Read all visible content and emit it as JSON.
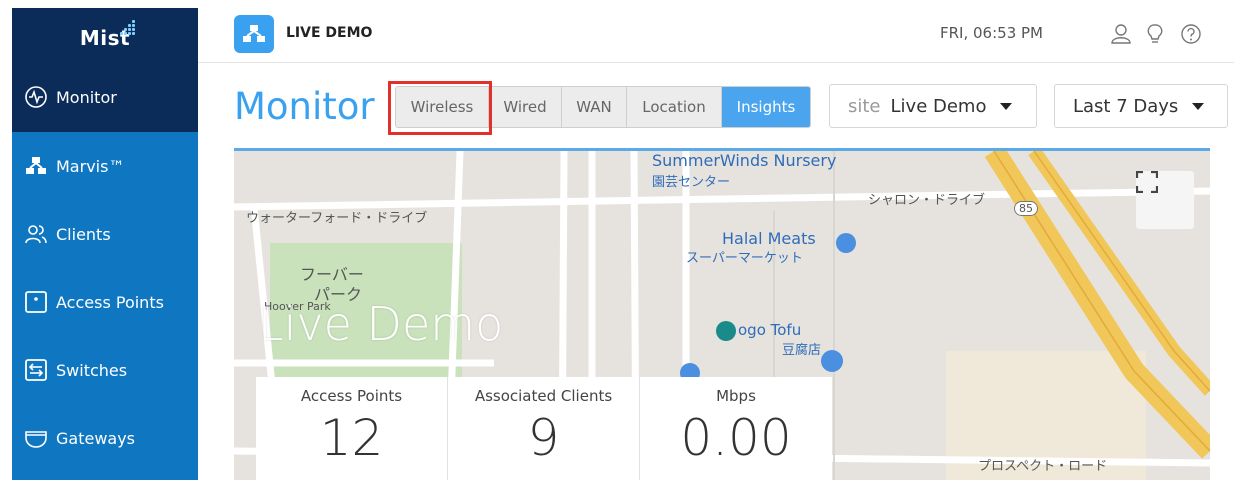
{
  "sidebar": {
    "logo": "Mist",
    "items": [
      {
        "label": "Monitor",
        "icon": "pulse-icon"
      },
      {
        "label": "Marvis™",
        "icon": "marvis-icon"
      },
      {
        "label": "Clients",
        "icon": "clients-icon"
      },
      {
        "label": "Access Points",
        "icon": "access-point-icon"
      },
      {
        "label": "Switches",
        "icon": "switch-icon"
      },
      {
        "label": "Gateways",
        "icon": "gateway-icon"
      }
    ]
  },
  "header": {
    "org_name": "LIVE DEMO",
    "time": "FRI, 06:53 PM"
  },
  "monitor": {
    "title": "Monitor",
    "tabs": [
      "Wireless",
      "Wired",
      "WAN",
      "Location",
      "Insights"
    ],
    "active_tab": "Insights",
    "site_prefix": "site",
    "site_value": "Live Demo",
    "date_range": "Last 7 Days"
  },
  "map": {
    "site_name": "Live Demo",
    "labels": {
      "nursery_en": "SummerWinds Nursery",
      "nursery_jp": "園芸センター",
      "sharon": "シャロン・ドライブ",
      "waterford": "ウォーターフォード・ドライブ",
      "halal_en": "Halal Meats",
      "halal_jp": "スーパーマーケット",
      "hoover_jp1": "フーバー",
      "hoover_jp2": "パーク",
      "hoover_en": "Hoover Park",
      "tofu_en": "ogo Tofu",
      "tofu_jp": "豆腐店",
      "prospect": "プロスペクト・ロード",
      "highway": "85"
    }
  },
  "stats": [
    {
      "label": "Access Points",
      "value": "12"
    },
    {
      "label": "Associated Clients",
      "value": "9"
    },
    {
      "label": "Mbps",
      "value": "0.00"
    }
  ],
  "colors": {
    "sidebar": "#0f77c2",
    "sidebar_active": "#0b2b58",
    "accent": "#3aa0f0",
    "highlight": "#e4302a"
  }
}
